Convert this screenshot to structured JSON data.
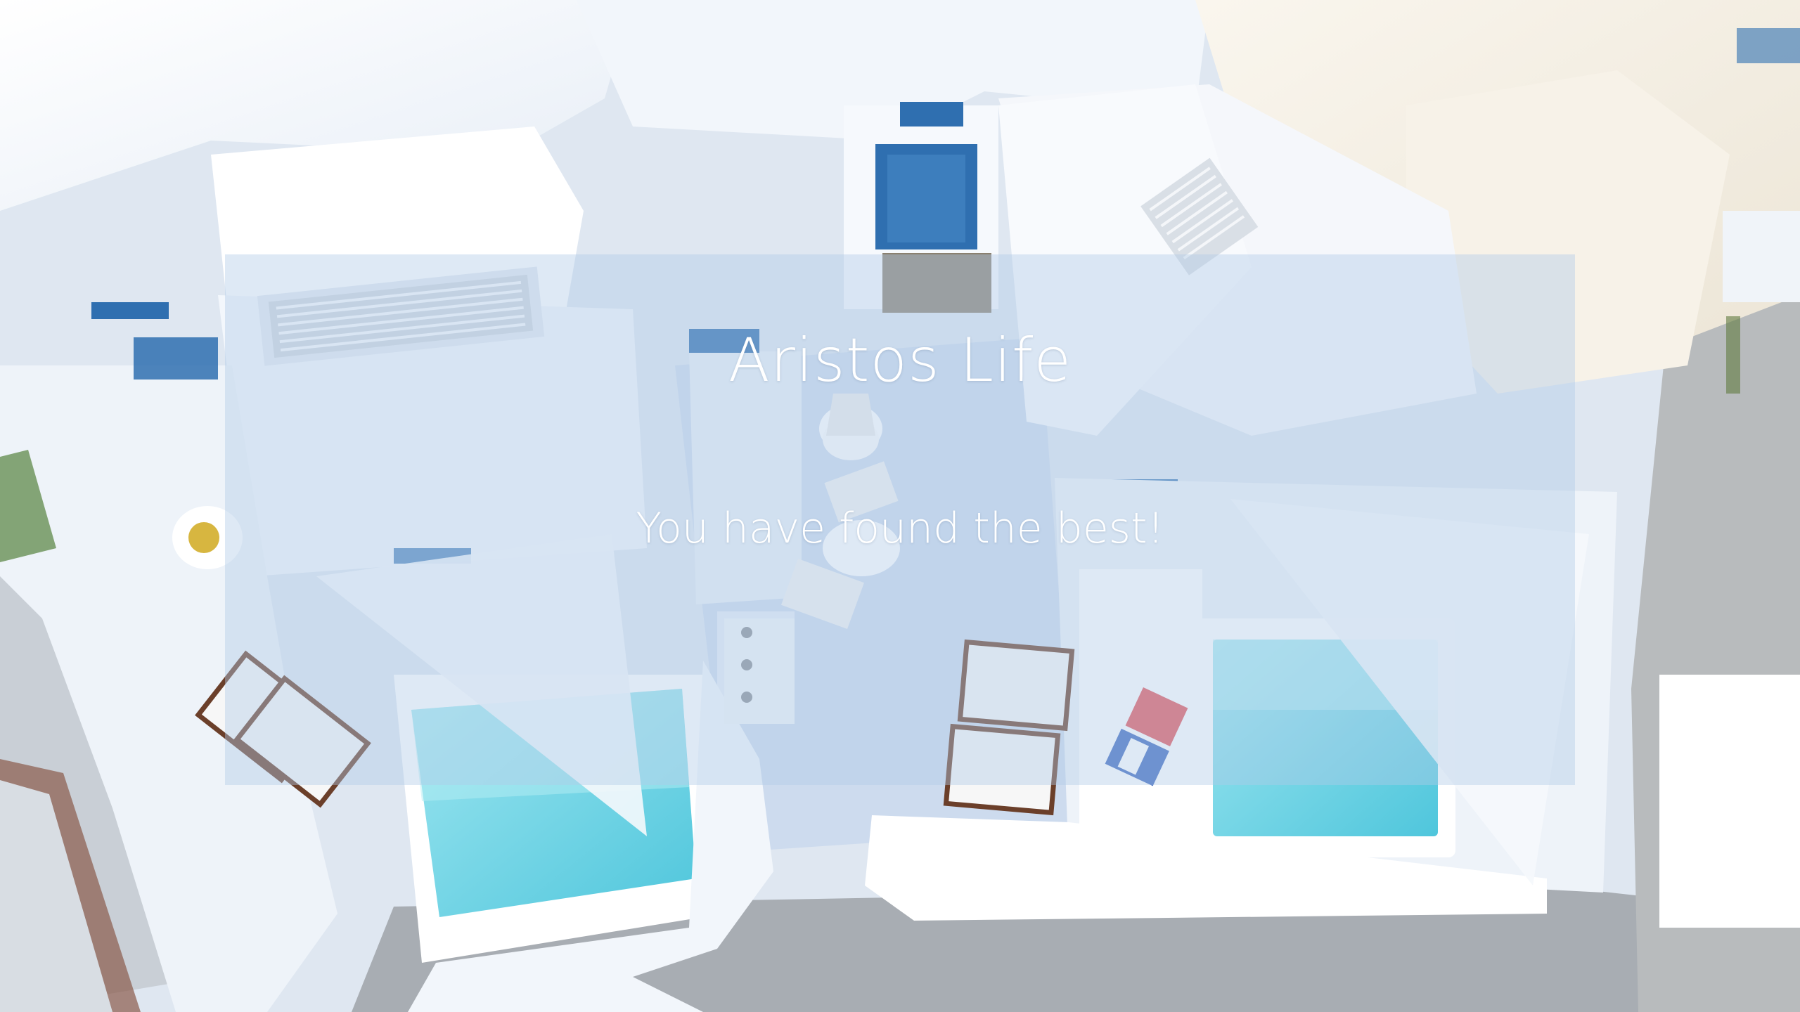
{
  "hero": {
    "title": "Aristos Life",
    "subtitle": "You have found the best!"
  },
  "background": {
    "image": "aerial-view-whitewashed-villa-with-pools",
    "accent_colors": {
      "wall_white": "#f4f7fb",
      "shadow_blue": "#c8d6ea",
      "pool_aqua": "#6fd6e6",
      "door_blue": "#2f6fb0",
      "pavement_gray": "#a9adb3",
      "overlay_tint": "#b0cbe8"
    }
  }
}
